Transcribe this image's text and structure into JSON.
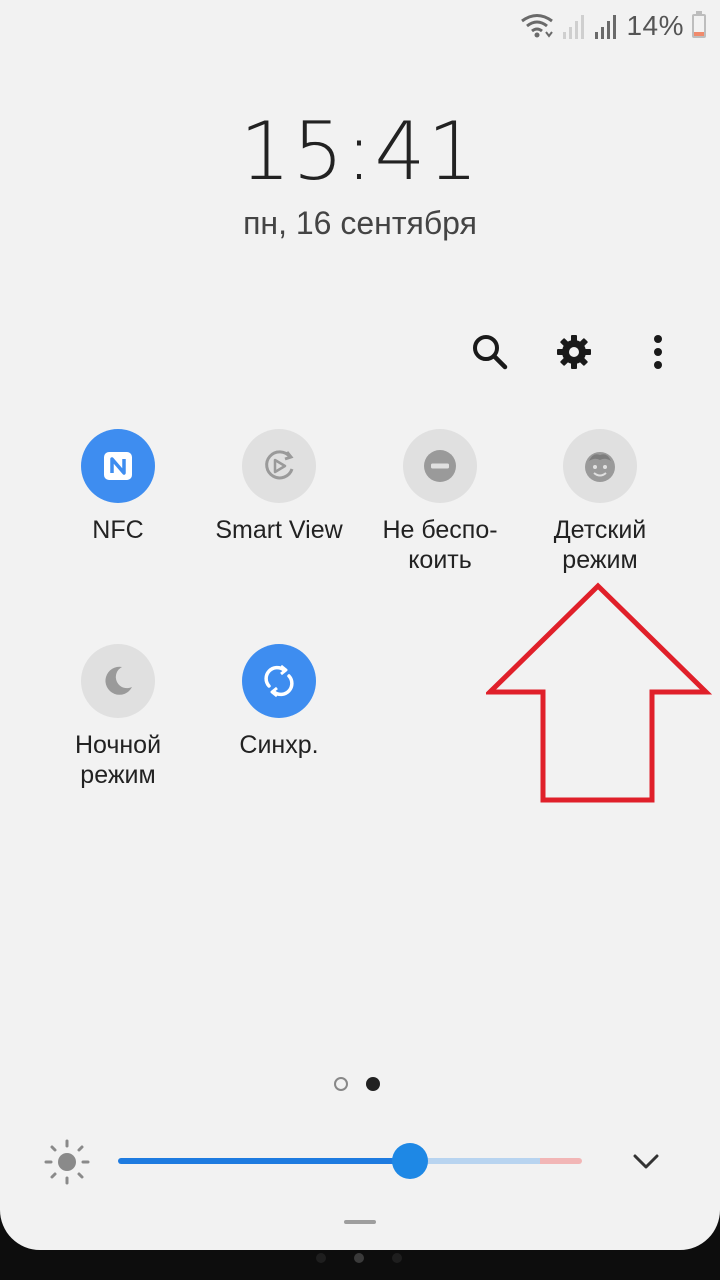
{
  "status_bar": {
    "battery_percent": "14%",
    "battery_level": 0.14,
    "icons": [
      "wifi-icon",
      "signal-icon",
      "signal-icon",
      "battery-icon"
    ]
  },
  "clock": {
    "time": "15:41",
    "date": "пн, 16 сентября"
  },
  "toolbar": {
    "icons": [
      "search-icon",
      "settings-gear-icon",
      "more-vert-icon"
    ]
  },
  "tiles": [
    {
      "id": "nfc",
      "label": "NFC",
      "icon": "nfc-icon",
      "active": true
    },
    {
      "id": "smart-view",
      "label": "Smart View",
      "icon": "smart-view-icon",
      "active": false
    },
    {
      "id": "dnd",
      "label": "Не беспо-\nкоить",
      "icon": "do-not-disturb-icon",
      "active": false
    },
    {
      "id": "kids",
      "label": "Детский\nрежим",
      "icon": "kids-mode-icon",
      "active": false
    },
    {
      "id": "night",
      "label": "Ночной\nрежим",
      "icon": "night-mode-icon",
      "active": false
    },
    {
      "id": "sync",
      "label": "Синхр.",
      "icon": "sync-icon",
      "active": true
    }
  ],
  "pagination": {
    "pages": 2,
    "current": 2
  },
  "brightness": {
    "level": 0.62,
    "icon": "brightness-icon"
  },
  "colors": {
    "panel_bg": "#f2f2f2",
    "active_tile": "#3e8df0",
    "inactive_tile": "#e0e0e0",
    "slider": "#1e88e5",
    "annotation_arrow": "#e0202a"
  },
  "annotation": {
    "type": "arrow",
    "points_to": "kids"
  }
}
